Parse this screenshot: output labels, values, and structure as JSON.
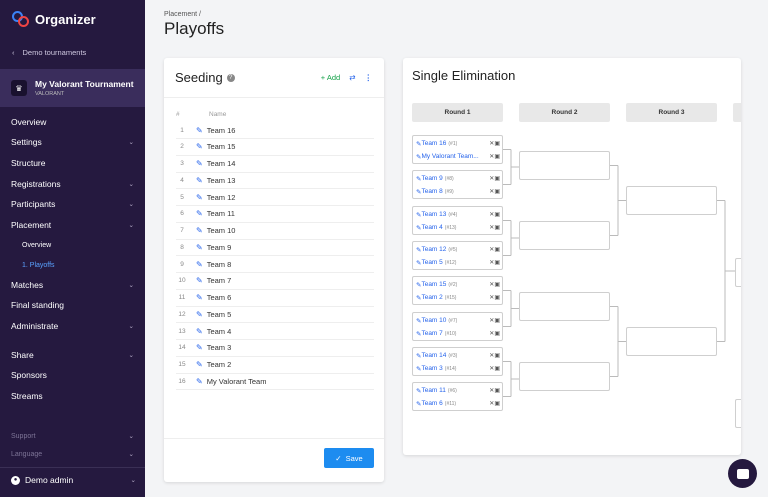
{
  "app": {
    "name": "Organizer"
  },
  "sidebar": {
    "back_label": "Demo tournaments",
    "tournament": {
      "name": "My Valorant Tournament",
      "game": "VALORANT"
    },
    "items": [
      {
        "label": "Overview",
        "has_chevron": false
      },
      {
        "label": "Settings",
        "has_chevron": true
      },
      {
        "label": "Structure",
        "has_chevron": false
      },
      {
        "label": "Registrations",
        "has_chevron": true
      },
      {
        "label": "Participants",
        "has_chevron": true
      },
      {
        "label": "Placement",
        "has_chevron": true
      },
      {
        "label": "Overview",
        "sub": true
      },
      {
        "label": "1. Playoffs",
        "sub": true,
        "active": true
      },
      {
        "label": "Matches",
        "has_chevron": true
      },
      {
        "label": "Final standing",
        "has_chevron": false
      },
      {
        "label": "Administrate",
        "has_chevron": true
      },
      {
        "label": "Share",
        "has_chevron": true
      },
      {
        "label": "Sponsors",
        "has_chevron": false
      },
      {
        "label": "Streams",
        "has_chevron": false
      },
      {
        "label": "Support",
        "has_chevron": true,
        "dim": true
      },
      {
        "label": "Language",
        "has_chevron": true,
        "dim": true
      }
    ],
    "user": "Demo admin"
  },
  "page": {
    "breadcrumb": "Placement /",
    "title": "Playoffs"
  },
  "seeding": {
    "title": "Seeding",
    "add_label": "Add",
    "col_num": "#",
    "col_name": "Name",
    "rows": [
      {
        "num": "1",
        "name": "Team 16"
      },
      {
        "num": "2",
        "name": "Team 15"
      },
      {
        "num": "3",
        "name": "Team 14"
      },
      {
        "num": "4",
        "name": "Team 13"
      },
      {
        "num": "5",
        "name": "Team 12"
      },
      {
        "num": "6",
        "name": "Team 11"
      },
      {
        "num": "7",
        "name": "Team 10"
      },
      {
        "num": "8",
        "name": "Team 9"
      },
      {
        "num": "9",
        "name": "Team 8"
      },
      {
        "num": "10",
        "name": "Team 7"
      },
      {
        "num": "11",
        "name": "Team 6"
      },
      {
        "num": "12",
        "name": "Team 5"
      },
      {
        "num": "13",
        "name": "Team 4"
      },
      {
        "num": "14",
        "name": "Team 3"
      },
      {
        "num": "15",
        "name": "Team 2"
      },
      {
        "num": "16",
        "name": "My Valorant Team"
      }
    ],
    "save_label": "Save"
  },
  "elimination": {
    "title": "Single Elimination",
    "rounds": [
      "Round 1",
      "Round 2",
      "Round 3"
    ],
    "matches": [
      {
        "teams": [
          {
            "name": "Team 16",
            "seed": "(#1)"
          },
          {
            "name": "My Valorant Team...",
            "seed": ""
          }
        ]
      },
      {
        "teams": [
          {
            "name": "Team 9",
            "seed": "(#8)"
          },
          {
            "name": "Team 8",
            "seed": "(#9)"
          }
        ]
      },
      {
        "teams": [
          {
            "name": "Team 13",
            "seed": "(#4)"
          },
          {
            "name": "Team 4",
            "seed": "(#13)"
          }
        ]
      },
      {
        "teams": [
          {
            "name": "Team 12",
            "seed": "(#5)"
          },
          {
            "name": "Team 5",
            "seed": "(#12)"
          }
        ]
      },
      {
        "teams": [
          {
            "name": "Team 15",
            "seed": "(#2)"
          },
          {
            "name": "Team 2",
            "seed": "(#15)"
          }
        ]
      },
      {
        "teams": [
          {
            "name": "Team 10",
            "seed": "(#7)"
          },
          {
            "name": "Team 7",
            "seed": "(#10)"
          }
        ]
      },
      {
        "teams": [
          {
            "name": "Team 14",
            "seed": "(#3)"
          },
          {
            "name": "Team 3",
            "seed": "(#14)"
          }
        ]
      },
      {
        "teams": [
          {
            "name": "Team 11",
            "seed": "(#6)"
          },
          {
            "name": "Team 6",
            "seed": "(#11)"
          }
        ]
      }
    ]
  },
  "icons": {
    "edit": "pencil-icon",
    "team_actions": "lock-icon",
    "chat": "chat-icon"
  },
  "colors": {
    "sidebar_bg": "#25193f",
    "accent": "#2563eb",
    "save": "#1d8cf0",
    "add": "#16a34a"
  }
}
